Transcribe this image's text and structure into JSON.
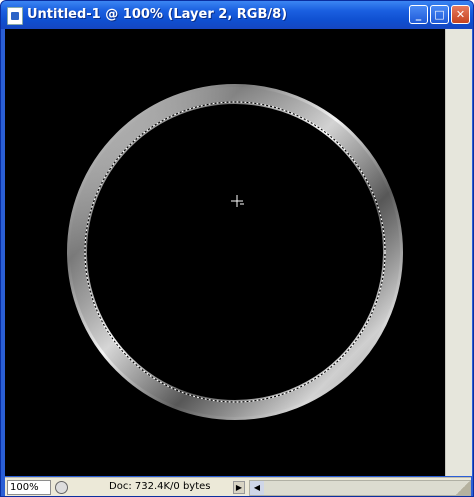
{
  "window": {
    "title": "Untitled-1 @ 100% (Layer 2, RGB/8)",
    "app_icon": "document-icon",
    "buttons": {
      "minimize": "_",
      "maximize": "□",
      "close": "✕"
    }
  },
  "canvas": {
    "background": "#000000",
    "ring_color": "#c0c0c0",
    "selection": "marching-ants-circle",
    "cursor": "crosshair-cursor-icon"
  },
  "status": {
    "zoom": "100%",
    "doc_info": "Doc: 732.4K/0 bytes",
    "arrow": "▶",
    "scroll_left": "◀"
  }
}
